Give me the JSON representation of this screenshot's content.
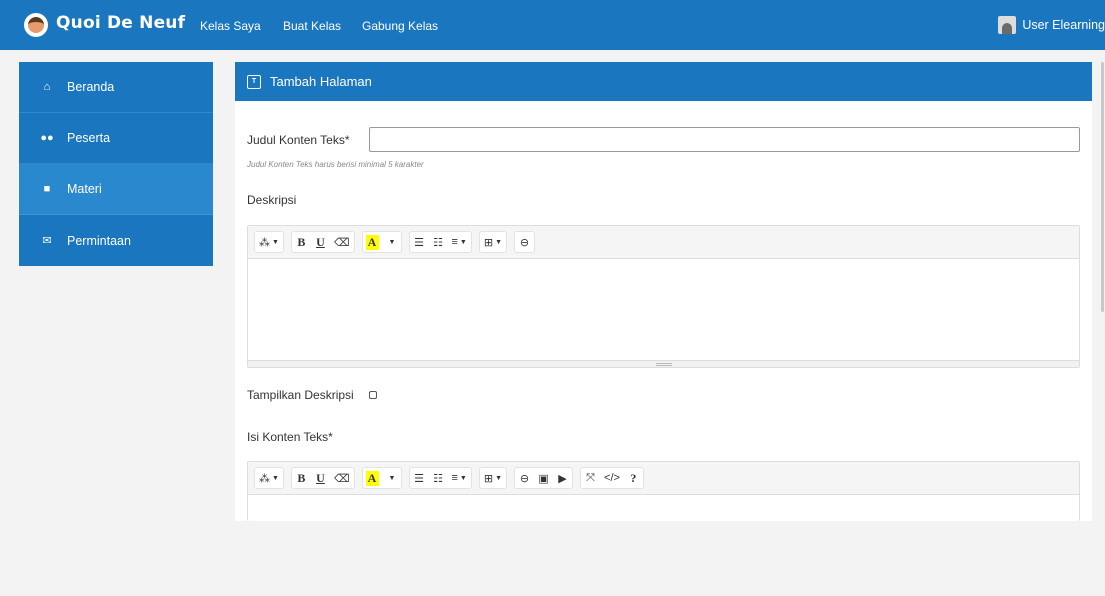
{
  "brand": {
    "name": "Quoi De Neuf",
    "logo_icon": "avatar-logo-icon"
  },
  "nav": [
    "Kelas Saya",
    "Buat Kelas",
    "Gabung Kelas"
  ],
  "user": {
    "name": "User Elearning",
    "icon": "user-avatar-icon"
  },
  "sidebar": {
    "items": [
      {
        "label": "Beranda",
        "icon": "home-icon"
      },
      {
        "label": "Peserta",
        "icon": "users-icon"
      },
      {
        "label": "Materi",
        "icon": "boxes-icon",
        "active": true
      },
      {
        "label": "Permintaan",
        "icon": "envelope-icon"
      }
    ]
  },
  "panel": {
    "title": "Tambah Halaman",
    "title_icon": "text-content-icon",
    "judul_label": "Judul Konten Teks*",
    "judul_value": "",
    "judul_hint": "Judul Konten Teks harus berisi minimal 5 karakter",
    "deskripsi_label": "Deskripsi",
    "tampilkan_label": "Tampilkan Deskripsi",
    "tampilkan_checked": false,
    "isi_label": "Isi Konten Teks*"
  },
  "colors": {
    "primary": "#1976bf",
    "active": "#2a88cf"
  }
}
